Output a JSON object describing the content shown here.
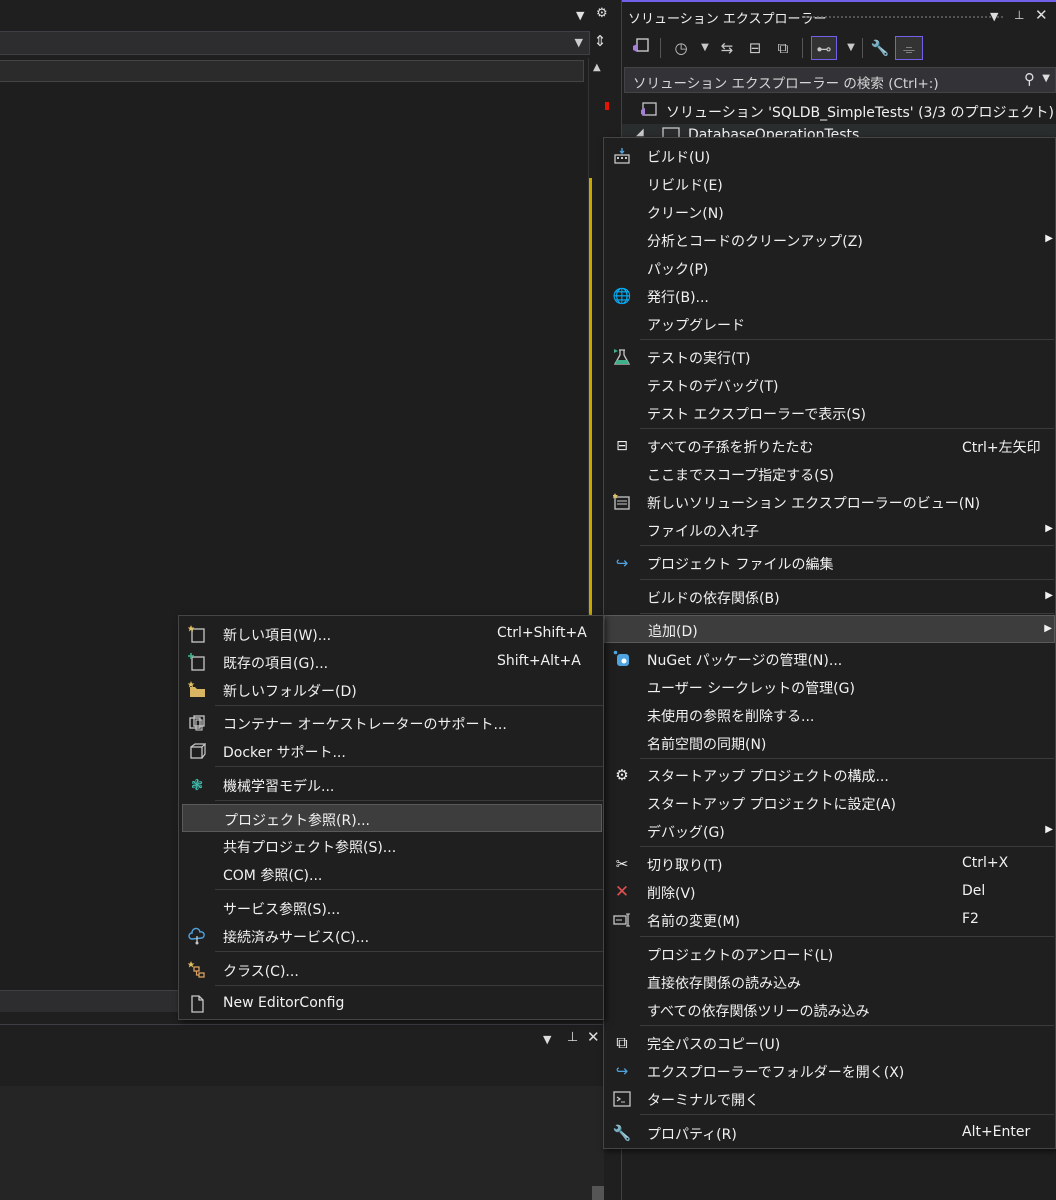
{
  "solution_explorer": {
    "title": "ソリューション エクスプローラー",
    "search_placeholder": "ソリューション エクスプローラー の検索 (Ctrl+:)",
    "solution_label": "ソリューション 'SQLDB_SimpleTests' (3/3 のプロジェクト)",
    "project_label": "DatabaseOperationTests"
  },
  "context_menu": {
    "items": [
      {
        "label": "ビルド(U)",
        "icon": "build-icon"
      },
      {
        "label": "リビルド(E)"
      },
      {
        "label": "クリーン(N)"
      },
      {
        "label": "分析とコードのクリーンアップ(Z)",
        "submenu": true
      },
      {
        "label": "パック(P)"
      },
      {
        "label": "発行(B)...",
        "icon": "globe-publish-icon"
      },
      {
        "label": "アップグレード"
      },
      {
        "label": "テストの実行(T)",
        "icon": "test-flask-icon"
      },
      {
        "label": "テストのデバッグ(T)"
      },
      {
        "label": "テスト エクスプローラーで表示(S)"
      },
      {
        "label": "すべての子孫を折りたたむ",
        "shortcut": "Ctrl+左矢印",
        "icon": "collapse-icon"
      },
      {
        "label": "ここまでスコープ指定する(S)"
      },
      {
        "label": "新しいソリューション エクスプローラーのビュー(N)",
        "icon": "new-view-icon"
      },
      {
        "label": "ファイルの入れ子",
        "submenu": true
      },
      {
        "label": "プロジェクト ファイルの編集",
        "icon": "edit-redo-icon"
      },
      {
        "label": "ビルドの依存関係(B)",
        "submenu": true
      },
      {
        "label": "追加(D)",
        "submenu": true
      },
      {
        "label": "NuGet パッケージの管理(N)...",
        "icon": "nuget-icon"
      },
      {
        "label": "ユーザー シークレットの管理(G)"
      },
      {
        "label": "未使用の参照を削除する..."
      },
      {
        "label": "名前空間の同期(N)"
      },
      {
        "label": "スタートアップ プロジェクトの構成...",
        "icon": "gear-icon"
      },
      {
        "label": "スタートアップ プロジェクトに設定(A)"
      },
      {
        "label": "デバッグ(G)",
        "submenu": true
      },
      {
        "label": "切り取り(T)",
        "shortcut": "Ctrl+X",
        "icon": "scissors-icon"
      },
      {
        "label": "削除(V)",
        "shortcut": "Del",
        "icon": "delete-x-icon"
      },
      {
        "label": "名前の変更(M)",
        "shortcut": "F2",
        "icon": "rename-icon"
      },
      {
        "label": "プロジェクトのアンロード(L)"
      },
      {
        "label": "直接依存関係の読み込み"
      },
      {
        "label": "すべての依存関係ツリーの読み込み"
      },
      {
        "label": "完全パスのコピー(U)",
        "icon": "copy-icon"
      },
      {
        "label": "エクスプローラーでフォルダーを開く(X)",
        "icon": "open-folder-icon"
      },
      {
        "label": "ターミナルで開く",
        "icon": "terminal-icon"
      },
      {
        "label": "プロパティ(R)",
        "shortcut": "Alt+Enter",
        "icon": "wrench-icon"
      }
    ]
  },
  "add_submenu": {
    "items": [
      {
        "label": "新しい項目(W)...",
        "shortcut": "Ctrl+Shift+A",
        "icon": "new-item-icon"
      },
      {
        "label": "既存の項目(G)...",
        "shortcut": "Shift+Alt+A",
        "icon": "existing-item-icon"
      },
      {
        "label": "新しいフォルダー(D)",
        "icon": "new-folder-icon"
      },
      {
        "label": "コンテナー オーケストレーターのサポート...",
        "icon": "container-icon"
      },
      {
        "label": "Docker サポート...",
        "icon": "docker-icon"
      },
      {
        "label": "機械学習モデル...",
        "icon": "ml-model-icon"
      },
      {
        "label": "プロジェクト参照(R)..."
      },
      {
        "label": "共有プロジェクト参照(S)..."
      },
      {
        "label": "COM 参照(C)..."
      },
      {
        "label": "サービス参照(S)..."
      },
      {
        "label": "接続済みサービス(C)...",
        "icon": "cloud-service-icon"
      },
      {
        "label": "クラス(C)...",
        "icon": "class-icon"
      },
      {
        "label": "New EditorConfig",
        "icon": "file-icon"
      }
    ]
  }
}
